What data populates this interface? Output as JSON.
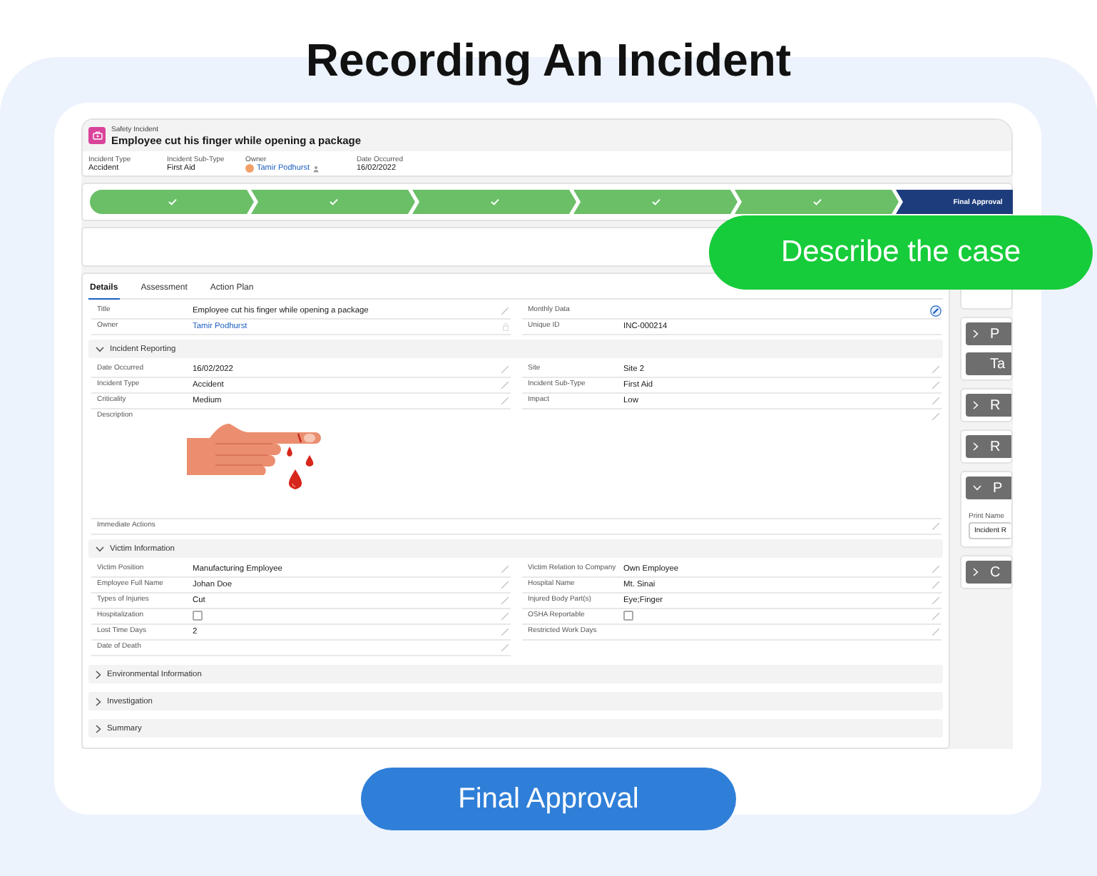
{
  "heading": "Recording An Incident",
  "record": {
    "object_type": "Safety Incident",
    "title": "Employee cut his finger while opening a package",
    "highlights": [
      {
        "label": "Incident Type",
        "value": "Accident",
        "kind": "text"
      },
      {
        "label": "Incident Sub-Type",
        "value": "First Aid",
        "kind": "text"
      },
      {
        "label": "Owner",
        "value": "Tamir Podhurst",
        "kind": "user"
      },
      {
        "label": "Date Occurred",
        "value": "16/02/2022",
        "kind": "text"
      }
    ]
  },
  "path": [
    {
      "completed": true,
      "current": false
    },
    {
      "completed": true,
      "current": false
    },
    {
      "completed": true,
      "current": false
    },
    {
      "completed": true,
      "current": false
    },
    {
      "completed": true,
      "current": false
    },
    {
      "label": "Final Approval",
      "completed": false,
      "current": true
    }
  ],
  "tabs": [
    {
      "label": "Details",
      "selected": true
    },
    {
      "label": "Assessment",
      "selected": false
    },
    {
      "label": "Action Plan",
      "selected": false
    }
  ],
  "top_fields": [
    [
      {
        "label": "Title",
        "value": "Employee cut his finger while opening a package",
        "kind": "text",
        "editable": true
      },
      {
        "label": "Monthly Data",
        "kind": "text",
        "active": true
      }
    ],
    [
      {
        "label": "Owner",
        "value": "Tamir Podhurst",
        "kind": "link",
        "locked": true
      },
      {
        "label": "Unique ID",
        "value": "INC-000214",
        "kind": "text"
      }
    ]
  ],
  "sections": [
    {
      "title": "Incident Reporting",
      "expanded": true,
      "rows": [
        [
          {
            "label": "Date Occurred",
            "value": "16/02/2022",
            "kind": "text",
            "editable": true
          },
          {
            "label": "Site",
            "value": "Site 2",
            "kind": "text",
            "editable": true
          }
        ],
        [
          {
            "label": "Incident Type",
            "value": "Accident",
            "kind": "text",
            "editable": true
          },
          {
            "label": "Incident Sub-Type",
            "value": "First Aid",
            "kind": "text",
            "editable": true
          }
        ],
        [
          {
            "label": "Criticality",
            "value": "Medium",
            "kind": "text",
            "editable": true
          },
          {
            "label": "Impact",
            "value": "Low",
            "kind": "text",
            "editable": true
          }
        ],
        [
          {
            "label": "Description",
            "kind": "image",
            "editable": true
          }
        ],
        [
          {
            "label": "Immediate Actions",
            "kind": "text",
            "editable": true
          }
        ]
      ]
    },
    {
      "title": "Victim Information",
      "expanded": true,
      "rows": [
        [
          {
            "label": "Victim Position",
            "value": "Manufacturing Employee",
            "kind": "text",
            "editable": true
          },
          {
            "label": "Victim Relation to Company",
            "value": "Own Employee",
            "kind": "text",
            "editable": true
          }
        ],
        [
          {
            "label": "Employee Full Name",
            "value": "Johan Doe",
            "kind": "text",
            "editable": true
          },
          {
            "label": "Hospital Name",
            "value": "Mt. Sinai",
            "kind": "text",
            "editable": true
          }
        ],
        [
          {
            "label": "Types of Injuries",
            "value": "Cut",
            "kind": "text",
            "editable": true
          },
          {
            "label": "Injured Body Part(s)",
            "value": "Eye;Finger",
            "kind": "text",
            "editable": true
          }
        ],
        [
          {
            "label": "Hospitalization",
            "kind": "checkbox",
            "checked": false,
            "editable": true
          },
          {
            "label": "OSHA Reportable",
            "kind": "checkbox",
            "checked": false,
            "editable": true
          }
        ],
        [
          {
            "label": "Lost Time Days",
            "value": "2",
            "kind": "text",
            "editable": true
          },
          {
            "label": "Restricted Work Days",
            "kind": "text",
            "editable": true
          }
        ],
        [
          {
            "label": "Date of Death",
            "kind": "text",
            "editable": true
          }
        ]
      ]
    },
    {
      "title": "Environmental Information",
      "expanded": false
    },
    {
      "title": "Investigation",
      "expanded": false
    },
    {
      "title": "Summary",
      "expanded": false
    }
  ],
  "sidebar": [
    {
      "items": [
        {
          "kind": "header",
          "label": "P",
          "expanded": false
        },
        {
          "kind": "button",
          "label": "Ta"
        }
      ]
    },
    {
      "items": [
        {
          "kind": "header",
          "label": "R",
          "expanded": false
        }
      ]
    },
    {
      "items": [
        {
          "kind": "header",
          "label": "R",
          "expanded": false
        }
      ]
    },
    {
      "items": [
        {
          "kind": "header",
          "label": "P",
          "expanded": true
        },
        {
          "kind": "field",
          "label": "Print Name",
          "value": "Incident R"
        }
      ]
    },
    {
      "items": [
        {
          "kind": "header",
          "label": "C",
          "expanded": false
        }
      ]
    }
  ],
  "callout": "Describe the case",
  "action_button": "Final Approval"
}
